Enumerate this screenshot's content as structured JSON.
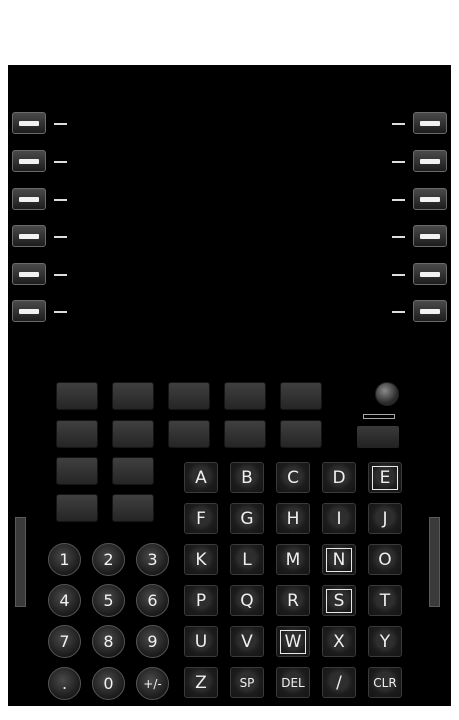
{
  "lsk_left": [
    "",
    "",
    "",
    "",
    "",
    ""
  ],
  "lsk_right": [
    "",
    "",
    "",
    "",
    "",
    ""
  ],
  "keypad": {
    "letters": [
      [
        "A",
        "B",
        "C",
        "D",
        "E"
      ],
      [
        "F",
        "G",
        "H",
        "I",
        "J"
      ],
      [
        "K",
        "L",
        "M",
        "N",
        "O"
      ],
      [
        "P",
        "Q",
        "R",
        "S",
        "T"
      ],
      [
        "U",
        "V",
        "W",
        "X",
        "Y"
      ],
      [
        "Z",
        "SP",
        "DEL",
        "/",
        "CLR"
      ]
    ],
    "highlighted": [
      "E",
      "N",
      "S",
      "W"
    ],
    "numbers": [
      [
        "1",
        "2",
        "3"
      ],
      [
        "4",
        "5",
        "6"
      ],
      [
        "7",
        "8",
        "9"
      ],
      [
        ".",
        "0",
        "+/-"
      ]
    ]
  },
  "icons": {
    "knob": "rotary-knob-icon"
  }
}
